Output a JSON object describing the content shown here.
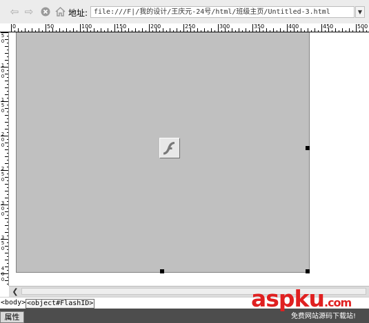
{
  "toolbar": {
    "back_icon": "back-arrow-icon",
    "forward_icon": "forward-arrow-icon",
    "stop_icon": "stop-icon",
    "home_icon": "home-icon",
    "address_label": "地址:",
    "address_value": "file:///F|/我的设计/王庆元-24号/html/班级主页/Untitled-3.html"
  },
  "ruler": {
    "horizontal_labels": [
      "0",
      "50",
      "100",
      "150",
      "200",
      "250",
      "300",
      "350",
      "400",
      "450",
      "500"
    ],
    "vertical_labels": [
      "5",
      "0",
      "1",
      "0",
      "0",
      "1",
      "5",
      "0",
      "2",
      "0",
      "0",
      "2",
      "5",
      "0",
      "3",
      "0",
      "0",
      "3",
      "5",
      "0",
      "4",
      "0",
      "0"
    ]
  },
  "flash": {
    "icon": "flash-player-icon",
    "background": "#c0c0c0"
  },
  "tagbar": {
    "tags": [
      "<body>",
      "<object#FlashID>"
    ]
  },
  "properties": {
    "tab_label": "属性"
  },
  "watermark": {
    "logo": "aspku",
    "suffix": ".com",
    "tagline": "免费网站源码下载站!"
  },
  "colors": {
    "flash_bg": "#c0c0c0",
    "logo_red": "#e02020"
  }
}
